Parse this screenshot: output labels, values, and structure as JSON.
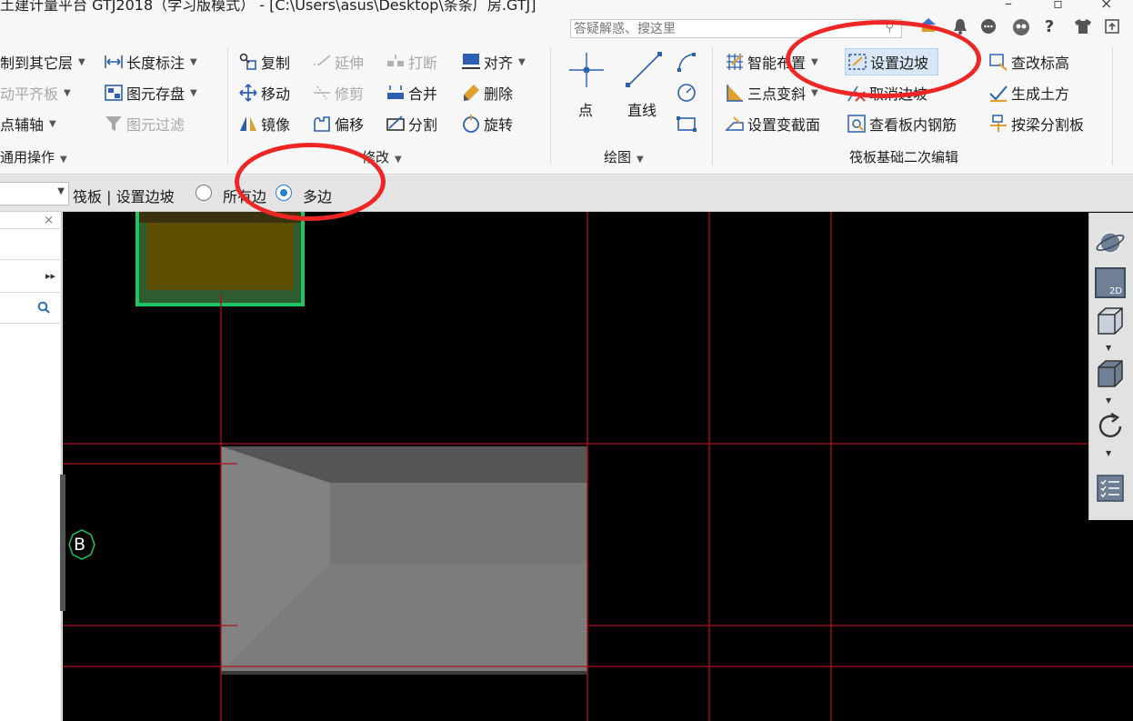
{
  "titlebar": {
    "title": "土建计量平台 GTJ2018（学习版模式） - [C:\\Users\\asus\\Desktop\\条条厂房.GTJ]",
    "search_placeholder": "答疑解惑、搜这里",
    "icons": [
      "search-icon",
      "bell-icon",
      "chat-icon",
      "mascot-icon",
      "help-icon",
      "shirt-icon",
      "restore-icon"
    ],
    "help_label": "?"
  },
  "ribbon": {
    "general": {
      "copy_to_layer": "制到其它层",
      "auto_align": "动平齐板",
      "point_axis": "点辅轴",
      "length_dim": "长度标注",
      "save_elem": "图元存盘",
      "filter_elem": "图元过滤",
      "group_label": "通用操作"
    },
    "modify": {
      "copy": "复制",
      "extend": "延伸",
      "break": "打断",
      "align": "对齐",
      "move": "移动",
      "trim": "修剪",
      "merge": "合并",
      "delete": "删除",
      "mirror": "镜像",
      "offset": "偏移",
      "split": "分割",
      "rotate": "旋转",
      "group_label": "修改"
    },
    "draw": {
      "point": "点",
      "line": "直线",
      "group_label": "绘图"
    },
    "raft": {
      "smart_layout": "智能布置",
      "set_slope": "设置边坡",
      "check_elev": "查改标高",
      "three_point_slope": "三点变斜",
      "cancel_slope": "取消边坡",
      "gen_earthwork": "生成土方",
      "set_section": "设置变截面",
      "view_rebar": "查看板内钢筋",
      "split_by_beam": "按梁分割板",
      "group_label": "筏板基础二次编辑"
    }
  },
  "optionbar": {
    "context": "筏板 | 设置边坡",
    "radio_all": "所有边",
    "radio_multi": "多边",
    "selected": "多边"
  },
  "canvas": {
    "axis_label": "B"
  },
  "viewbar": {
    "mode_2d": "2D"
  },
  "colors": {
    "grid_line": "#b0101c",
    "annotation": "#ee2626",
    "raft_fill": "#6d6d6d",
    "column_fill": "#5e4f00",
    "column_border": "#1fc463"
  }
}
